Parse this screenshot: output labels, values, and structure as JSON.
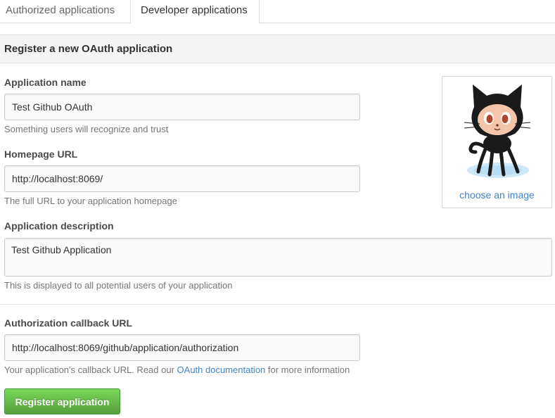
{
  "tabs": [
    {
      "label": "Authorized applications",
      "active": false
    },
    {
      "label": "Developer applications",
      "active": true
    }
  ],
  "panel": {
    "title": "Register a new OAuth application"
  },
  "fields": {
    "app_name": {
      "label": "Application name",
      "value": "Test Github OAuth",
      "hint": "Something users will recognize and trust"
    },
    "homepage": {
      "label": "Homepage URL",
      "value": "http://localhost:8069/",
      "hint": "The full URL to your application homepage"
    },
    "description": {
      "label": "Application description",
      "value": "Test Github Application",
      "hint": "This is displayed to all potential users of your application"
    },
    "callback": {
      "label": "Authorization callback URL",
      "value": "http://localhost:8069/github/application/authorization",
      "hint_prefix": "Your application's callback URL. Read our ",
      "hint_link": "OAuth documentation",
      "hint_suffix": " for more information"
    }
  },
  "image": {
    "icon": "octocat-icon",
    "link_label": "choose an image"
  },
  "submit": {
    "label": "Register application"
  },
  "colors": {
    "link": "#4183c4",
    "button_green": "#6cc644"
  }
}
